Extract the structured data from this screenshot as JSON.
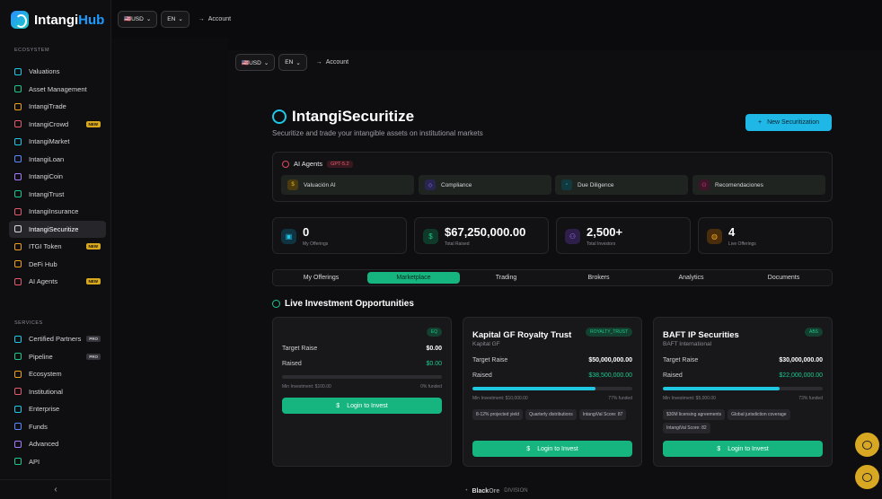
{
  "brand": {
    "name_a": "Intangi",
    "name_b": "Hub"
  },
  "sidebar": {
    "ecosystem_label": "ECOSYSTEM",
    "items": [
      {
        "label": "Valuations",
        "icon": "bar-chart-icon"
      },
      {
        "label": "Asset Management",
        "icon": "network-icon"
      },
      {
        "label": "IntangiTrade",
        "icon": "wallet-icon"
      },
      {
        "label": "IntangiCrowd",
        "icon": "rocket-icon",
        "badge": "NEW"
      },
      {
        "label": "IntangiMarket",
        "icon": "store-icon"
      },
      {
        "label": "IntangiLoan",
        "icon": "card-icon"
      },
      {
        "label": "IntangiCoin",
        "icon": "wallet-icon"
      },
      {
        "label": "IntangiTrust",
        "icon": "document-icon"
      },
      {
        "label": "IntangiInsurance",
        "icon": "shield-icon"
      },
      {
        "label": "IntangiSecuritize",
        "icon": "bank-icon",
        "active": true
      },
      {
        "label": "ITGI Token",
        "icon": "coins-icon",
        "badge": "NEW"
      },
      {
        "label": "DeFi Hub",
        "icon": "coins-icon"
      },
      {
        "label": "AI Agents",
        "icon": "bot-icon",
        "badge": "NEW"
      }
    ],
    "services_label": "SERVICES",
    "services": [
      {
        "label": "Certified Partners",
        "icon": "users-icon",
        "badge": "PRO"
      },
      {
        "label": "Pipeline",
        "icon": "git-icon",
        "badge": "PRO"
      },
      {
        "label": "Ecosystem",
        "icon": "network-icon"
      },
      {
        "label": "Institutional",
        "icon": "building-icon"
      },
      {
        "label": "Enterprise",
        "icon": "building-icon"
      },
      {
        "label": "Funds",
        "icon": "bank-icon"
      },
      {
        "label": "Advanced",
        "icon": "sparkle-icon"
      },
      {
        "label": "API",
        "icon": "code-icon"
      }
    ],
    "collapse": "‹"
  },
  "topbar": {
    "currency": "🇺🇸USD",
    "lang": "EN",
    "account": "Account"
  },
  "page": {
    "title": "IntangiSecuritize",
    "subtitle": "Securitize and trade your intangible assets on institutional markets",
    "new_button": "New Securitization",
    "agents": {
      "title": "AI Agents",
      "badge": "GPT-5.2",
      "items": [
        "Valuación AI",
        "Compliance",
        "Due Diligence",
        "Recomendaciones"
      ]
    },
    "stats": [
      {
        "value": "0",
        "label": "My Offerings"
      },
      {
        "value": "$67,250,000.00",
        "label": "Total Raised"
      },
      {
        "value": "2,500+",
        "label": "Total Investors"
      },
      {
        "value": "4",
        "label": "Live Offerings"
      }
    ],
    "tabs": [
      "My Offerings",
      "Marketplace",
      "Trading",
      "Brokers",
      "Analytics",
      "Documents"
    ],
    "active_tab": 1,
    "section_title": "Live Investment Opportunities",
    "cards": [
      {
        "name": "",
        "company": "",
        "tag": "EQ",
        "target_label": "Target Raise",
        "target": "$0.00",
        "raised_label": "Raised",
        "raised": "$0.00",
        "progress": 0,
        "min": "Min Investment: $100.00",
        "funded": "0% funded",
        "chips": [],
        "button": "Login to Invest"
      },
      {
        "name": "Kapital GF Royalty Trust",
        "company": "Kapital GF",
        "tag": "ROYALTY_TRUST",
        "target_label": "Target Raise",
        "target": "$50,000,000.00",
        "raised_label": "Raised",
        "raised": "$38,500,000.00",
        "progress": 0.77,
        "min": "Min Investment: $10,000.00",
        "funded": "77% funded",
        "chips": [
          "8-12% projected yield",
          "Quarterly distributions",
          "IntangiVal Score: 87"
        ],
        "button": "Login to Invest"
      },
      {
        "name": "BAFT IP Securities",
        "company": "BAFT International",
        "tag": "ABS",
        "target_label": "Target Raise",
        "target": "$30,000,000.00",
        "raised_label": "Raised",
        "raised": "$22,000,000.00",
        "progress": 0.73,
        "min": "Min Investment: $5,000.00",
        "funded": "73% funded",
        "chips": [
          "$30M licensing agreements",
          "Global jurisdiction coverage",
          "IntangiVal Score: 82"
        ],
        "button": "Login to Invest"
      }
    ]
  },
  "footer": {
    "brand_a": "Black",
    "brand_b": "Ore",
    "division": "DIVISION"
  }
}
